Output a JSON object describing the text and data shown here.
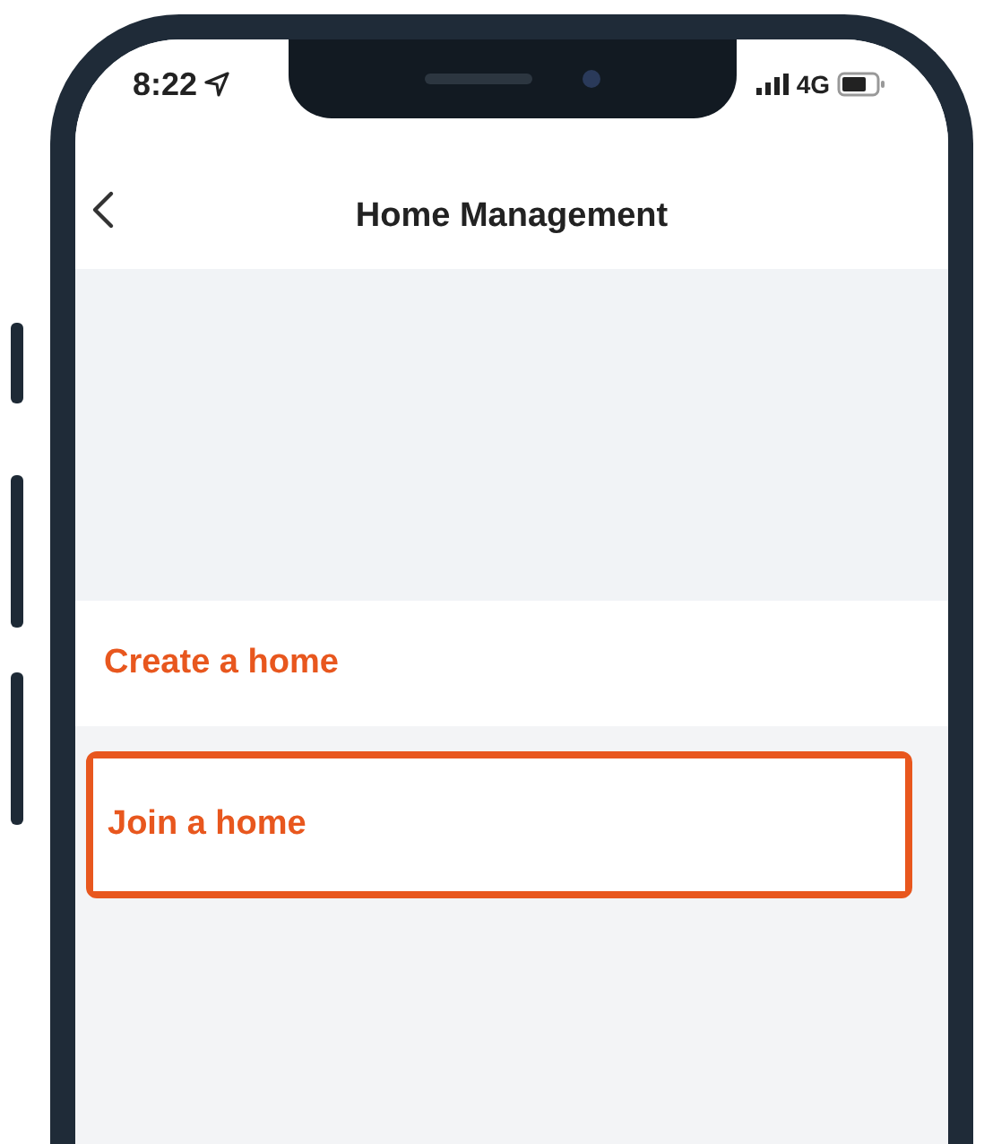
{
  "status_bar": {
    "time": "8:22",
    "network": "4G"
  },
  "nav": {
    "title": "Home Management"
  },
  "items": [
    {
      "label": "Create a home",
      "highlighted": false
    },
    {
      "label": "Join a home",
      "highlighted": true
    }
  ]
}
